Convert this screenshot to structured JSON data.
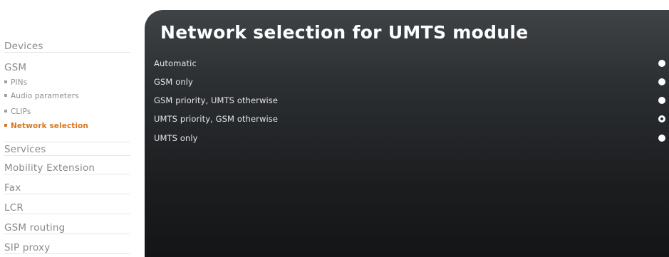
{
  "sidebar": {
    "devices": "Devices",
    "gsm": "GSM",
    "gsm_sub": [
      {
        "label": "PINs"
      },
      {
        "label": "Audio parameters"
      },
      {
        "label": "CLIPs"
      },
      {
        "label": "Network selection",
        "active": true
      }
    ],
    "items": [
      {
        "label": "Services"
      },
      {
        "label": "Mobility Extension"
      },
      {
        "label": "Fax"
      },
      {
        "label": "LCR"
      },
      {
        "label": "GSM routing"
      },
      {
        "label": "SIP proxy"
      }
    ]
  },
  "main": {
    "title": "Network selection for UMTS module",
    "options": [
      {
        "label": "Automatic",
        "selected": false
      },
      {
        "label": "GSM only",
        "selected": false
      },
      {
        "label": "GSM priority, UMTS otherwise",
        "selected": false
      },
      {
        "label": "UMTS priority, GSM otherwise",
        "selected": true
      },
      {
        "label": "UMTS only",
        "selected": false
      }
    ]
  },
  "colors": {
    "accent": "#d9761d",
    "panel_top": "#3f4346",
    "panel_bottom": "#141516",
    "nav_text": "#8a8a8a"
  }
}
